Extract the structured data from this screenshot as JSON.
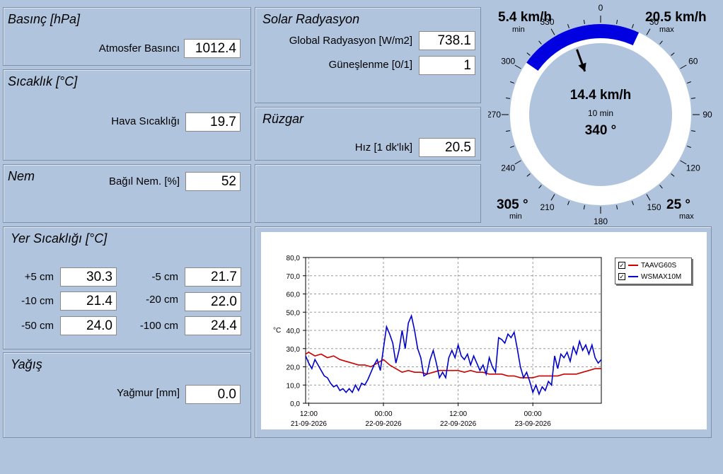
{
  "pressure": {
    "title": "Basınç [hPa]",
    "label": "Atmosfer Basıncı",
    "value": "1012.4"
  },
  "temperature": {
    "title": "Sıcaklık [°C]",
    "label": "Hava Sıcaklığı",
    "value": "19.7"
  },
  "humidity": {
    "title": "Nem",
    "label": "Bağıl Nem. [%]",
    "value": "52"
  },
  "solar": {
    "title": "Solar Radyasyon",
    "global_label": "Global Radyasyon [W/m2]",
    "global_value": "738.1",
    "sun_label": "Güneşlenme [0/1]",
    "sun_value": "1"
  },
  "wind": {
    "title": "Rüzgar",
    "label": "Hız [1 dk'lık]",
    "value": "20.5"
  },
  "ground": {
    "title": "Yer Sıcaklığı [°C]",
    "items": [
      {
        "label": "+5 cm",
        "value": "30.3"
      },
      {
        "label": "-5 cm",
        "value": "21.7"
      },
      {
        "label": "-10 cm",
        "value": "21.4"
      },
      {
        "label": "-20 cm",
        "value": "22.0"
      },
      {
        "label": "-50 cm",
        "value": "24.0"
      },
      {
        "label": "-100 cm",
        "value": "24.4"
      }
    ]
  },
  "rain": {
    "title": "Yağış",
    "label": "Yağmur [mm]",
    "value": "0.0"
  },
  "gauge": {
    "speed_min": "5.4 km/h",
    "speed_min_label": "min",
    "speed_max": "20.5 km/h",
    "speed_max_label": "max",
    "center_speed": "14.4 km/h",
    "center_period": "10 min",
    "center_dir": "340 °",
    "dir_min": "305 °",
    "dir_min_label": "min",
    "dir_max": "25 °",
    "dir_max_label": "max",
    "direction_deg": 340,
    "arc_from_deg": 305,
    "arc_to_deg": 25,
    "ticks": [
      "0",
      "30",
      "60",
      "90",
      "120",
      "150",
      "180",
      "210",
      "240",
      "270",
      "300",
      "330"
    ],
    "colors": {
      "arc": "#0000e0",
      "ring": "#ffffff",
      "inner": "#b0c4de"
    }
  },
  "chart_data": {
    "type": "line",
    "ylabel": "°C",
    "ylim": [
      0,
      80
    ],
    "yticks": [
      "0,0",
      "10,0",
      "20,0",
      "30,0",
      "40,0",
      "50,0",
      "60,0",
      "70,0",
      "80,0"
    ],
    "xticks": [
      {
        "time": "12:00",
        "date": "21-09-2026",
        "h": 0
      },
      {
        "time": "00:00",
        "date": "22-09-2026",
        "h": 12
      },
      {
        "time": "12:00",
        "date": "22-09-2026",
        "h": 24
      },
      {
        "time": "00:00",
        "date": "23-09-2026",
        "h": 36
      }
    ],
    "xlim_hours": [
      -0.5,
      47
    ],
    "grid": true,
    "legend_position": "top-right",
    "series": [
      {
        "name": "TAAVG60S",
        "color": "#cc0000",
        "points": [
          [
            -0.5,
            27
          ],
          [
            0,
            28
          ],
          [
            1,
            26
          ],
          [
            2,
            27
          ],
          [
            3,
            25
          ],
          [
            4,
            26
          ],
          [
            5,
            24
          ],
          [
            6,
            23
          ],
          [
            7,
            22
          ],
          [
            8,
            21
          ],
          [
            9,
            21
          ],
          [
            10,
            20
          ],
          [
            11,
            22
          ],
          [
            12,
            24
          ],
          [
            13,
            21
          ],
          [
            14,
            19
          ],
          [
            15,
            17
          ],
          [
            16,
            18
          ],
          [
            17,
            17
          ],
          [
            18,
            17
          ],
          [
            19,
            16
          ],
          [
            20,
            17
          ],
          [
            21,
            18
          ],
          [
            22,
            18
          ],
          [
            23,
            18
          ],
          [
            24,
            18
          ],
          [
            25,
            17
          ],
          [
            26,
            18
          ],
          [
            27,
            17
          ],
          [
            28,
            17
          ],
          [
            29,
            16
          ],
          [
            30,
            16
          ],
          [
            31,
            16
          ],
          [
            32,
            15
          ],
          [
            33,
            15
          ],
          [
            34,
            14
          ],
          [
            35,
            14
          ],
          [
            36,
            14
          ],
          [
            37,
            15
          ],
          [
            38,
            15
          ],
          [
            39,
            15
          ],
          [
            40,
            15
          ],
          [
            41,
            16
          ],
          [
            42,
            16
          ],
          [
            43,
            16
          ],
          [
            44,
            17
          ],
          [
            45,
            18
          ],
          [
            46,
            19
          ],
          [
            47,
            19
          ]
        ]
      },
      {
        "name": "WSMAX10M",
        "color": "#0000cc",
        "points": [
          [
            -0.5,
            26
          ],
          [
            0,
            22
          ],
          [
            0.5,
            19
          ],
          [
            1,
            24
          ],
          [
            1.5,
            21
          ],
          [
            2,
            18
          ],
          [
            2.5,
            15
          ],
          [
            3,
            14
          ],
          [
            3.5,
            11
          ],
          [
            4,
            9
          ],
          [
            4.5,
            10
          ],
          [
            5,
            7
          ],
          [
            5.5,
            8
          ],
          [
            6,
            6
          ],
          [
            6.5,
            8
          ],
          [
            7,
            6
          ],
          [
            7.5,
            10
          ],
          [
            8,
            7
          ],
          [
            8.5,
            11
          ],
          [
            9,
            10
          ],
          [
            9.5,
            13
          ],
          [
            10,
            17
          ],
          [
            10.5,
            21
          ],
          [
            11,
            24
          ],
          [
            11.5,
            18
          ],
          [
            12,
            30
          ],
          [
            12.5,
            42
          ],
          [
            13,
            38
          ],
          [
            13.5,
            33
          ],
          [
            14,
            22
          ],
          [
            14.5,
            29
          ],
          [
            15,
            40
          ],
          [
            15.5,
            30
          ],
          [
            16,
            44
          ],
          [
            16.5,
            48
          ],
          [
            17,
            40
          ],
          [
            17.5,
            30
          ],
          [
            18,
            25
          ],
          [
            18.5,
            15
          ],
          [
            19,
            16
          ],
          [
            19.5,
            24
          ],
          [
            20,
            29
          ],
          [
            20.5,
            22
          ],
          [
            21,
            14
          ],
          [
            21.5,
            17
          ],
          [
            22,
            14
          ],
          [
            22.5,
            25
          ],
          [
            23,
            29
          ],
          [
            23.5,
            25
          ],
          [
            24,
            32
          ],
          [
            24.5,
            26
          ],
          [
            25,
            24
          ],
          [
            25.5,
            27
          ],
          [
            26,
            21
          ],
          [
            26.5,
            26
          ],
          [
            27,
            22
          ],
          [
            27.5,
            18
          ],
          [
            28,
            21
          ],
          [
            28.5,
            16
          ],
          [
            29,
            25
          ],
          [
            29.5,
            20
          ],
          [
            30,
            17
          ],
          [
            30.5,
            36
          ],
          [
            31,
            35
          ],
          [
            31.5,
            33
          ],
          [
            32,
            38
          ],
          [
            32.5,
            36
          ],
          [
            33,
            39
          ],
          [
            33.5,
            30
          ],
          [
            34,
            20
          ],
          [
            34.5,
            14
          ],
          [
            35,
            17
          ],
          [
            35.5,
            12
          ],
          [
            36,
            6
          ],
          [
            36.5,
            10
          ],
          [
            37,
            5
          ],
          [
            37.5,
            9
          ],
          [
            38,
            7
          ],
          [
            38.5,
            12
          ],
          [
            39,
            10
          ],
          [
            39.5,
            26
          ],
          [
            40,
            19
          ],
          [
            40.5,
            27
          ],
          [
            41,
            25
          ],
          [
            41.5,
            28
          ],
          [
            42,
            23
          ],
          [
            42.5,
            31
          ],
          [
            43,
            27
          ],
          [
            43.5,
            34
          ],
          [
            44,
            29
          ],
          [
            44.5,
            32
          ],
          [
            45,
            27
          ],
          [
            45.5,
            32
          ],
          [
            46,
            25
          ],
          [
            46.5,
            22
          ],
          [
            47,
            24
          ]
        ]
      }
    ]
  }
}
